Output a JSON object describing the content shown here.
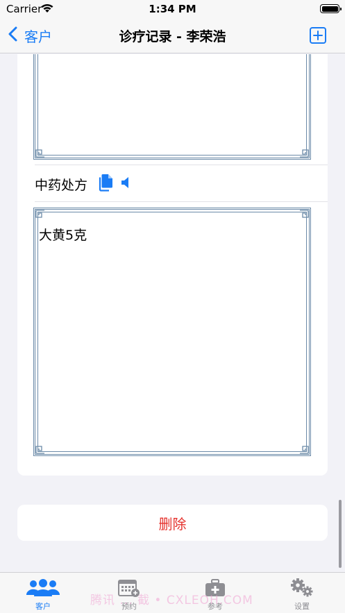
{
  "status_bar": {
    "carrier": "Carrier",
    "time": "1:34 PM"
  },
  "nav": {
    "back_label": "客户",
    "title": "诊疗记录 - 李荣浩"
  },
  "section": {
    "label": "中药处方",
    "prescription_text": "大黄5克"
  },
  "delete_label": "删除",
  "tabs": [
    {
      "label": "客户",
      "icon": "people-icon",
      "active": true
    },
    {
      "label": "预约",
      "icon": "calendar-add-icon",
      "active": false
    },
    {
      "label": "参考",
      "icon": "medical-kit-icon",
      "active": false
    },
    {
      "label": "设置",
      "icon": "gears-icon",
      "active": false
    }
  ],
  "watermark": "腾讯 ... 截 • CXLEOH.COM",
  "colors": {
    "accent": "#1a7cf5",
    "delete": "#e5322d",
    "frame": "#6b8aa8",
    "background": "#f2f2f7"
  }
}
